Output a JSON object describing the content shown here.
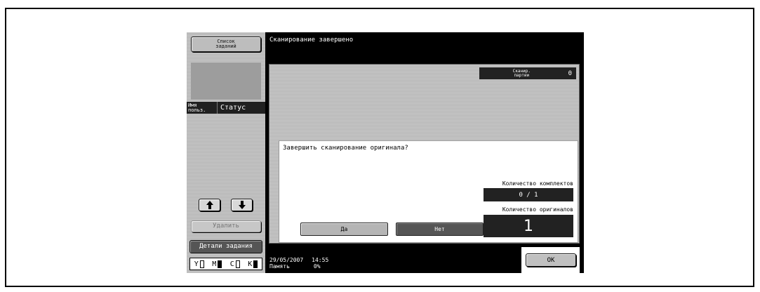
{
  "sidebar": {
    "job_list_button": "Список\nзаданий",
    "col_user": "Имя\nпольз.",
    "col_status": "Статус",
    "delete_button": "Удалить",
    "job_details_button": "Детали задания",
    "toner": [
      {
        "label": "Y",
        "level": "low"
      },
      {
        "label": "M",
        "level": "full"
      },
      {
        "label": "C",
        "level": "low"
      },
      {
        "label": "K",
        "level": "full"
      }
    ]
  },
  "header": {
    "title": "Сканирование завершено"
  },
  "batch": {
    "label": "Сканир.\nпартии",
    "value": "0"
  },
  "dialog": {
    "question": "Завершить сканирование оригинала?",
    "sets_label": "Количество комплектов",
    "sets_value": "0 / 1",
    "originals_label": "Количество оригиналов",
    "originals_value": "1",
    "yes_button": "Да",
    "no_button": "Нет"
  },
  "footer": {
    "date": "29/05/2007",
    "time": "14:55",
    "memory_label": "Память",
    "memory_value": "0%",
    "ok_button": "OK"
  }
}
